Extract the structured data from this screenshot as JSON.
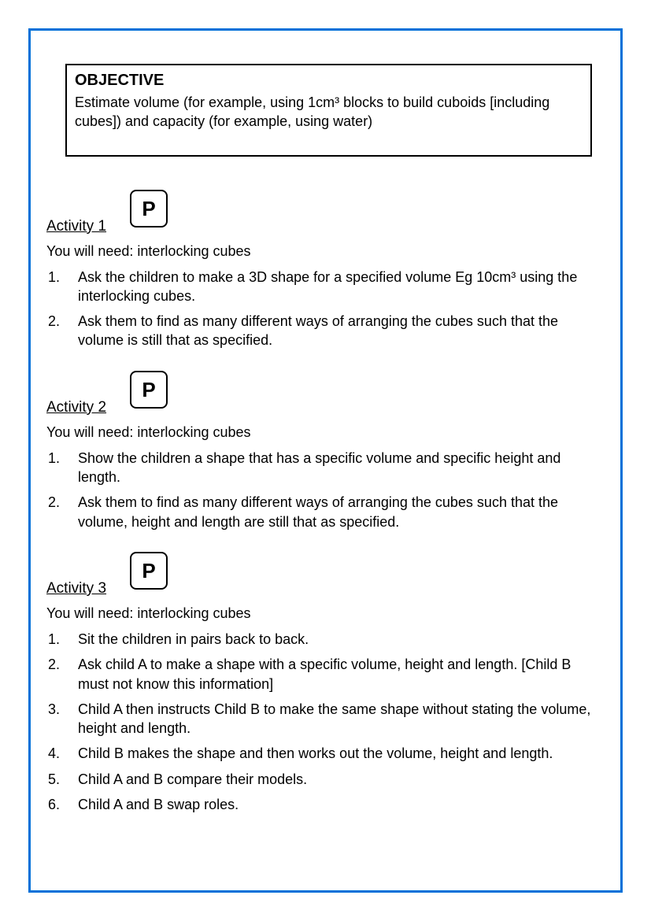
{
  "objective": {
    "heading": "OBJECTIVE",
    "body": "Estimate volume (for example, using  1cm³ blocks to build cuboids [including cubes]) and capacity (for example, using water)"
  },
  "badge_letter": "P",
  "activities": [
    {
      "title": "Activity 1",
      "need": "You will need:   interlocking cubes",
      "steps": [
        "Ask the children to make a 3D shape for a specified volume Eg 10cm³ using the interlocking cubes.",
        "Ask them to find as many different ways of arranging the cubes such that the volume is still that as specified."
      ]
    },
    {
      "title": "Activity 2",
      "need": "You will need:   interlocking cubes",
      "steps": [
        "Show the children a shape that has a specific volume and specific height and length.",
        "Ask them to find as many different ways of arranging the cubes such that the volume, height and length are still that as specified."
      ]
    },
    {
      "title": "Activity 3",
      "need": "You will need:   interlocking cubes",
      "steps": [
        "Sit the children in pairs back to back.",
        "Ask child A to make a shape with a specific volume, height and length. [Child B must not know this information]",
        "Child A then instructs Child B to make the same shape without stating the volume, height and length.",
        "Child B makes the shape and then works out the volume, height and length.",
        "Child A and B compare their models.",
        "Child A and B swap roles."
      ]
    }
  ]
}
